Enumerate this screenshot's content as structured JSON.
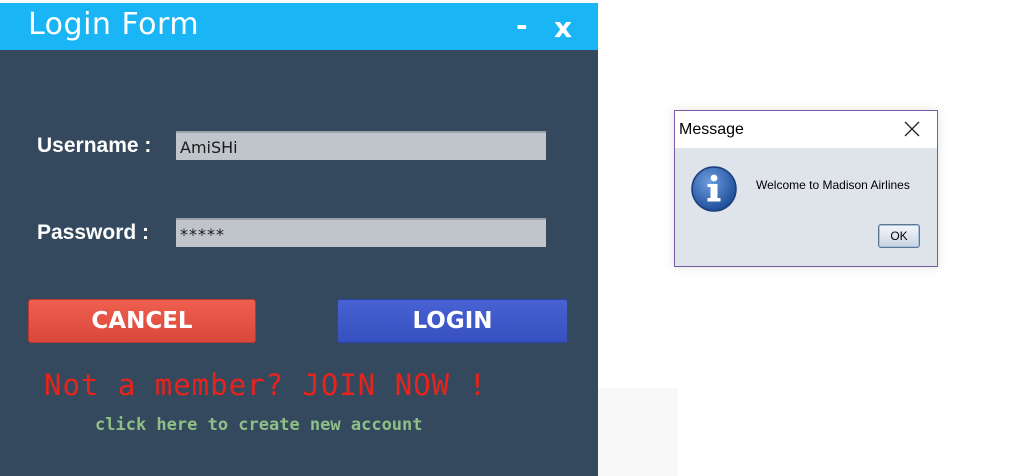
{
  "login_form": {
    "title": "Login Form",
    "minimize_label": "-",
    "close_label": "x",
    "username_label": "Username :",
    "username_value": "AmiSHi",
    "password_label": "Password :",
    "password_value": "*****",
    "cancel_label": "CANCEL",
    "login_label": "LOGIN",
    "join_text": "Not a member? JOIN NOW !",
    "create_account_text": "click here to create new account"
  },
  "message_dialog": {
    "title": "Message",
    "message": "Welcome to Madison Airlines",
    "ok_label": "OK",
    "icon": "info-icon",
    "close_icon": "close-icon"
  },
  "colors": {
    "title_bar": "#19b5f5",
    "window_bg": "#34495e",
    "cancel_button": "#e8574a",
    "login_button": "#3f59ca",
    "join_text": "#e8231b",
    "create_link": "#8fbf86",
    "info_icon": "#2f5fa8"
  }
}
